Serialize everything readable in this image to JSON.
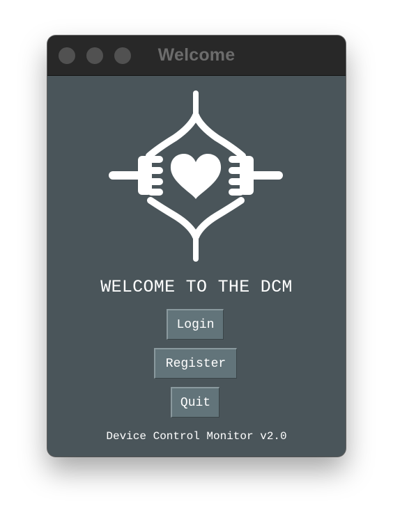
{
  "window": {
    "title": "Welcome"
  },
  "main": {
    "logo_icon": "hands-heart-logo-icon",
    "welcome_text": "WELCOME TO THE DCM",
    "buttons": {
      "login": "Login",
      "register": "Register",
      "quit": "Quit"
    },
    "footer": "Device Control Monitor v2.0"
  },
  "colors": {
    "window_bg": "#4a555a",
    "titlebar_bg": "#282828",
    "button_bg": "#62747a",
    "text": "#ffffff"
  }
}
